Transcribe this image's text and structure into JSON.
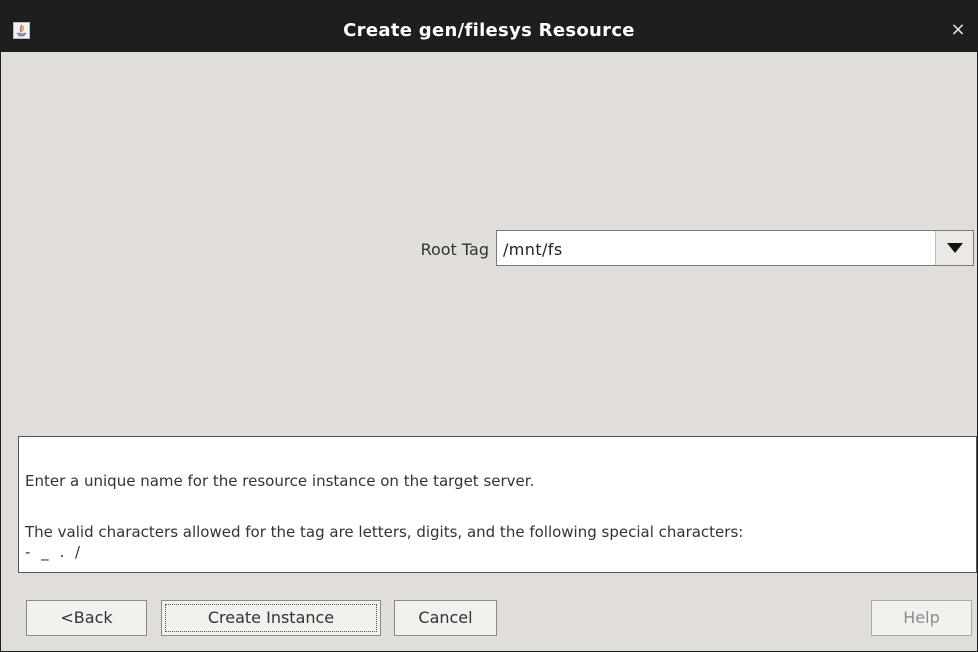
{
  "window": {
    "title": "Create gen/filesys Resource",
    "close_glyph": "×",
    "app_icon": "java-icon"
  },
  "form": {
    "root_tag_label": "Root Tag",
    "root_tag_value": "/mnt/fs"
  },
  "description": {
    "line1": "Enter a unique name for the resource instance on the target server.",
    "line2": "The valid characters allowed for the tag are letters, digits, and the following special characters:",
    "line3": "- _ . /"
  },
  "buttons": {
    "back": "<Back",
    "create_instance": "Create Instance",
    "cancel": "Cancel",
    "help": "Help"
  },
  "colors": {
    "titlebar": "#1e1e1e",
    "window_background": "#e1ddd8",
    "disabled_text": "#8c8c8c"
  }
}
